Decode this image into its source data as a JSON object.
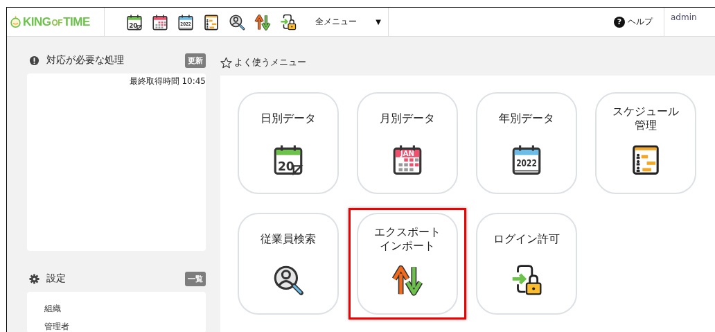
{
  "header": {
    "logo": {
      "parts": [
        "KING",
        "OF",
        "TIME"
      ]
    },
    "shortcuts": [
      {
        "kind": "calendar-day",
        "icon_text": "20"
      },
      {
        "kind": "calendar-month"
      },
      {
        "kind": "calendar-year",
        "icon_text": "2022"
      },
      {
        "kind": "schedule"
      },
      {
        "kind": "search-person"
      },
      {
        "kind": "export-import"
      },
      {
        "kind": "login-lock"
      }
    ],
    "all_menu": {
      "label": "全メニュー",
      "caret": "▼"
    },
    "help": {
      "label": "ヘルプ",
      "icon_text": "?"
    },
    "user": {
      "name": "admin"
    }
  },
  "sidebar": {
    "sections": [
      {
        "kind": "alert",
        "title": "対応が必要な処理",
        "button": "更新",
        "note": "最終取得時間 10:45"
      },
      {
        "kind": "gear",
        "title": "設定",
        "button": "一覧",
        "items": [
          "組織",
          "管理者"
        ]
      }
    ]
  },
  "favorites": {
    "title": "よく使うメニュー",
    "tiles": [
      {
        "label": "日別データ",
        "kind": "calendar-day",
        "icon_text": "20",
        "highlighted": false
      },
      {
        "label": "月別データ",
        "kind": "calendar-month",
        "icon_text": "JAN",
        "highlighted": false
      },
      {
        "label": "年別データ",
        "kind": "calendar-year",
        "icon_text": "2022",
        "highlighted": false
      },
      {
        "label": "スケジュール管理",
        "kind": "schedule",
        "highlighted": false
      },
      {
        "label": "従業員検索",
        "kind": "search-person",
        "highlighted": false
      },
      {
        "label": "エクスポートインポート",
        "kind": "export-import",
        "highlighted": true
      },
      {
        "label": "ログイン許可",
        "kind": "login-lock",
        "highlighted": false
      }
    ]
  }
}
